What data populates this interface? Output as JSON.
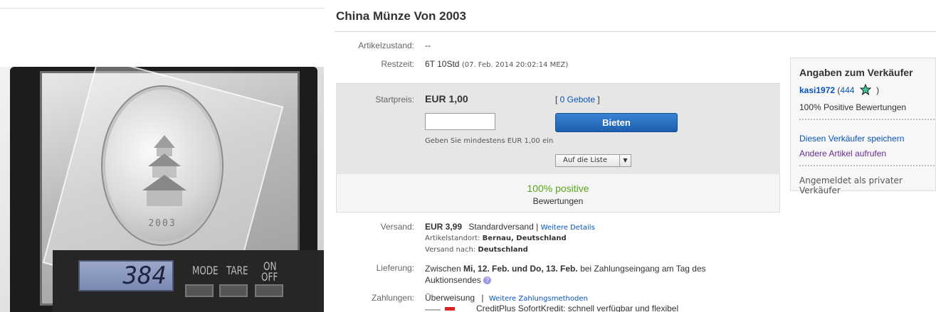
{
  "item": {
    "title": "China Münze Von 2003"
  },
  "photo": {
    "scale_display": "384",
    "coin_year": "2003",
    "buttons": [
      "MODE",
      "TARE",
      "ON",
      "OFF"
    ]
  },
  "details": {
    "condition_label": "Artikelzustand:",
    "condition_value": "--",
    "time_label": "Restzeit:",
    "time_value": "6T 10Std",
    "time_end": "(07. Feb. 2014  20:02:14 MEZ)"
  },
  "bid": {
    "start_label": "Startpreis:",
    "start_price": "EUR 1,00",
    "bids_link": "0 Gebote",
    "bid_input_value": "",
    "bid_button": "Bieten",
    "min_hint": "Geben Sie mindestens EUR 1,00 ein",
    "watch_button": "Auf die Liste"
  },
  "feedback": {
    "percent": "100% positive",
    "sub": "Bewertungen"
  },
  "shipping": {
    "label": "Versand:",
    "price": "EUR 3,99",
    "method": "Standardversand |",
    "details_link": "Weitere Details",
    "location_label": "Artikelstandort:",
    "location_value": "Bernau, Deutschland",
    "ship_to_label": "Versand nach:",
    "ship_to_value": "Deutschland"
  },
  "delivery": {
    "label": "Lieferung:",
    "text_pre": "Zwischen",
    "dates": "Mi, 12. Feb. und Do, 13. Feb.",
    "text_post": "bei Zahlungseingang am Tag des",
    "text_line2": "Auktionsendes"
  },
  "payment": {
    "label": "Zahlungen:",
    "method": "Überweisung",
    "sep": "|",
    "more_link": "Weitere Zahlungsmethoden",
    "credit_text": "CreditPlus SofortKredit: schnell verfügbar und flexibel"
  },
  "seller": {
    "title": "Angaben zum Verkäufer",
    "username": "kasi1972",
    "score": "444",
    "positive": "100% Positive Bewertungen",
    "save_link": "Diesen Verkäufer speichern",
    "other_link": "Andere Artikel aufrufen",
    "registered": "Angemeldet als privater Verkäufer"
  }
}
